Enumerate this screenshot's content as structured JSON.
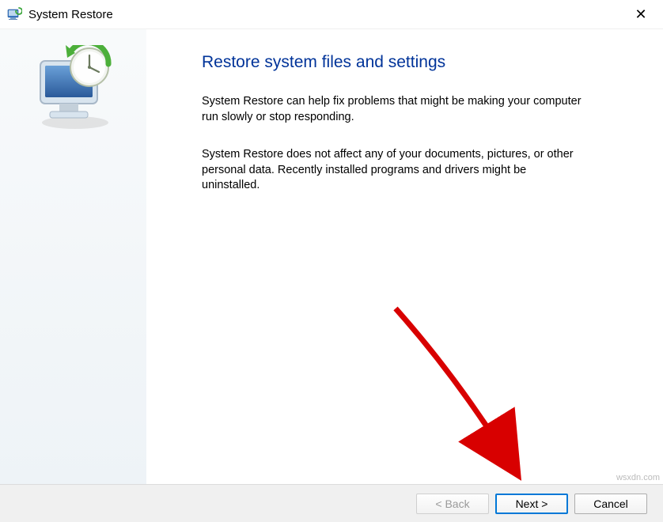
{
  "titlebar": {
    "title": "System Restore"
  },
  "main": {
    "heading": "Restore system files and settings",
    "para1": "System Restore can help fix problems that might be making your computer run slowly or stop responding.",
    "para2": "System Restore does not affect any of your documents, pictures, or other personal data. Recently installed programs and drivers might be uninstalled."
  },
  "buttons": {
    "back": "< Back",
    "next": "Next >",
    "cancel": "Cancel"
  },
  "watermark": "wsxdn.com"
}
